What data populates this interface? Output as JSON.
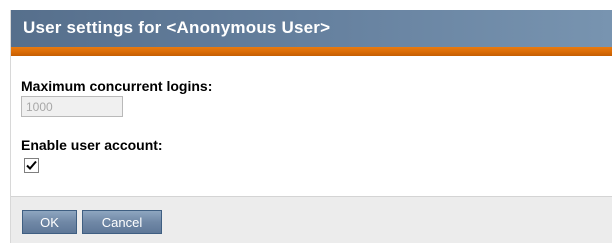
{
  "dialog": {
    "title": "User settings for <Anonymous User>"
  },
  "fields": {
    "max_logins_label": "Maximum concurrent logins:",
    "max_logins_value": "1000",
    "enable_account_label": "Enable user account:",
    "enable_account_checked": true
  },
  "buttons": {
    "ok_label": "OK",
    "cancel_label": "Cancel"
  },
  "colors": {
    "title_bar": "#6782a0",
    "accent_bar": "#d86a05",
    "button": "#7088a6"
  },
  "icons": {
    "checkbox": "checkmark-icon"
  }
}
